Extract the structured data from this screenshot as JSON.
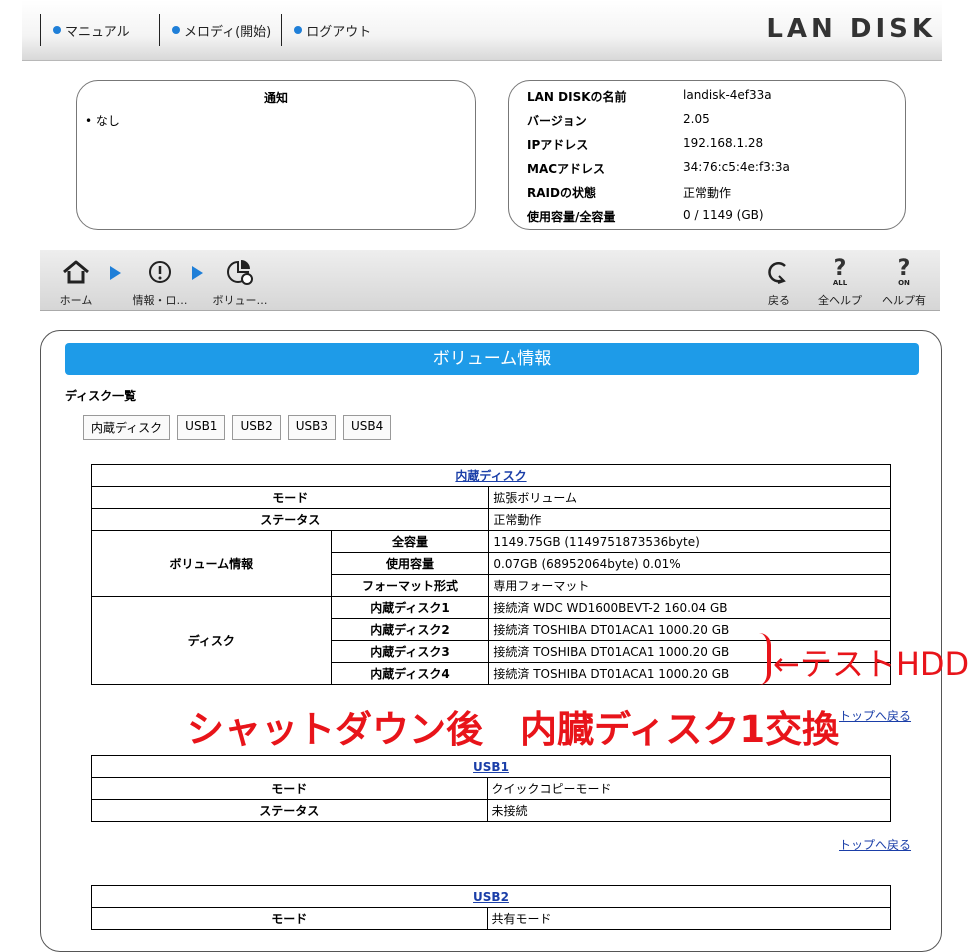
{
  "topbar": {
    "links": [
      "マニュアル",
      "メロディ(開始)",
      "ログアウト"
    ],
    "logo": "LAN DISK"
  },
  "notice": {
    "title": "通知",
    "items": [
      "なし"
    ]
  },
  "device": {
    "rows": [
      {
        "key": "LAN DISKの名前",
        "value": "landisk-4ef33a"
      },
      {
        "key": "バージョン",
        "value": "2.05"
      },
      {
        "key": "IPアドレス",
        "value": "192.168.1.28"
      },
      {
        "key": "MACアドレス",
        "value": "34:76:c5:4e:f3:3a"
      },
      {
        "key": "RAIDの状態",
        "value": "正常動作"
      },
      {
        "key": "使用容量/全容量",
        "value": "0 / 1149 (GB)"
      }
    ]
  },
  "toolbar": {
    "home": "ホーム",
    "info": "情報・ロ…",
    "volume": "ボリュー…",
    "back": "戻る",
    "all_help": "全ヘルプ",
    "help_on": "ヘルプ有",
    "all_badge": "ALL",
    "on_badge": "ON"
  },
  "main": {
    "header": "ボリューム情報",
    "disk_list_title": "ディスク一覧",
    "tabs": [
      "内蔵ディスク",
      "USB1",
      "USB2",
      "USB3",
      "USB4"
    ],
    "internal": {
      "caption": "内蔵ディスク",
      "mode_label": "モード",
      "mode_value": "拡張ボリューム",
      "status_label": "ステータス",
      "status_value": "正常動作",
      "volume_label": "ボリューム情報",
      "volume_rows": [
        {
          "key": "全容量",
          "value": "1149.75GB (1149751873536byte)"
        },
        {
          "key": "使用容量",
          "value": "0.07GB (68952064byte) 0.01%"
        },
        {
          "key": "フォーマット形式",
          "value": "専用フォーマット"
        }
      ],
      "disk_label": "ディスク",
      "disk_rows": [
        {
          "key": "内蔵ディスク1",
          "value": "接続済 WDC WD1600BEVT-2 160.04 GB"
        },
        {
          "key": "内蔵ディスク2",
          "value": "接続済 TOSHIBA DT01ACA1 1000.20 GB"
        },
        {
          "key": "内蔵ディスク3",
          "value": "接続済 TOSHIBA DT01ACA1 1000.20 GB"
        },
        {
          "key": "内蔵ディスク4",
          "value": "接続済 TOSHIBA DT01ACA1 1000.20 GB"
        }
      ]
    },
    "usb1": {
      "caption": "USB1",
      "mode_label": "モード",
      "mode_value": "クイックコピーモード",
      "status_label": "ステータス",
      "status_value": "未接続"
    },
    "usb2": {
      "caption": "USB2",
      "mode_label": "モード",
      "mode_value": "共有モード"
    },
    "top_link": "トップへ戻る",
    "annotation_hdd": "←テストHDD",
    "annotation_shutdown": "シャットダウン後　内臓ディスク1交換"
  },
  "colors": {
    "accent": "#1e9be8",
    "link": "#1a3ea8",
    "annotation": "#e8141a"
  }
}
